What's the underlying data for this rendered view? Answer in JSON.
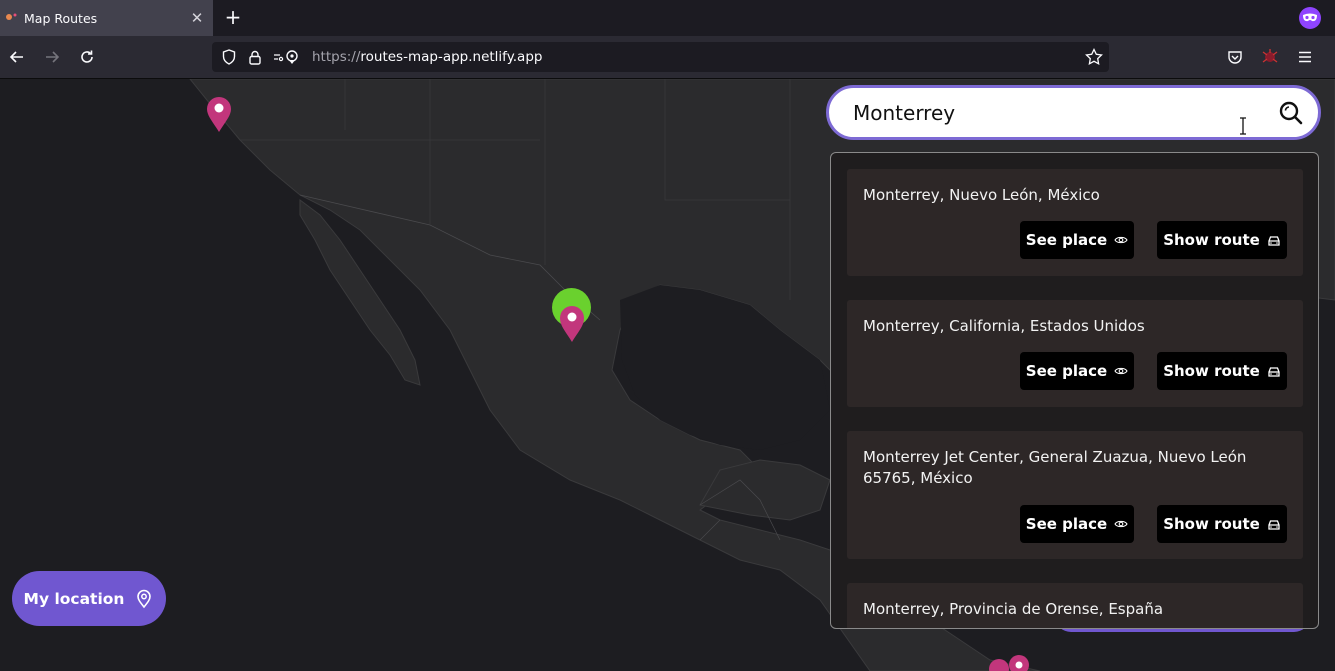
{
  "browser": {
    "tab_title": "Map Routes",
    "new_tab_label": "+",
    "url_scheme": "https://",
    "url_host": "routes-map-app.netlify.app"
  },
  "search": {
    "value": "Monterrey",
    "placeholder": ""
  },
  "results": [
    {
      "title": "Monterrey, Nuevo León, México",
      "see_label": "See place",
      "route_label": "Show route"
    },
    {
      "title": "Monterrey, California, Estados Unidos",
      "see_label": "See place",
      "route_label": "Show route"
    },
    {
      "title": "Monterrey Jet Center, General Zuazua, Nuevo León 65765, México",
      "see_label": "See place",
      "route_label": "Show route"
    },
    {
      "title": "Monterrey, Provincia de Orense, España"
    }
  ],
  "my_location_label": "My location",
  "colors": {
    "accent": "#7057d0",
    "marker": "#c2367c",
    "user_marker": "#6ad12e"
  }
}
